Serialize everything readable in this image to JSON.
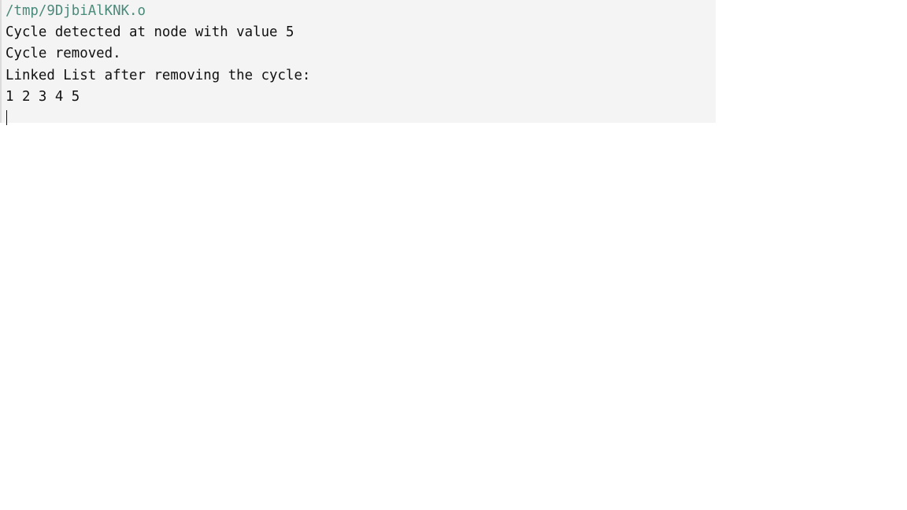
{
  "terminal": {
    "path": "/tmp/9DjbiAlKNK.o",
    "lines": [
      "Cycle detected at node with value 5",
      "Cycle removed.",
      "Linked List after removing the cycle:",
      "1 2 3 4 5"
    ]
  }
}
